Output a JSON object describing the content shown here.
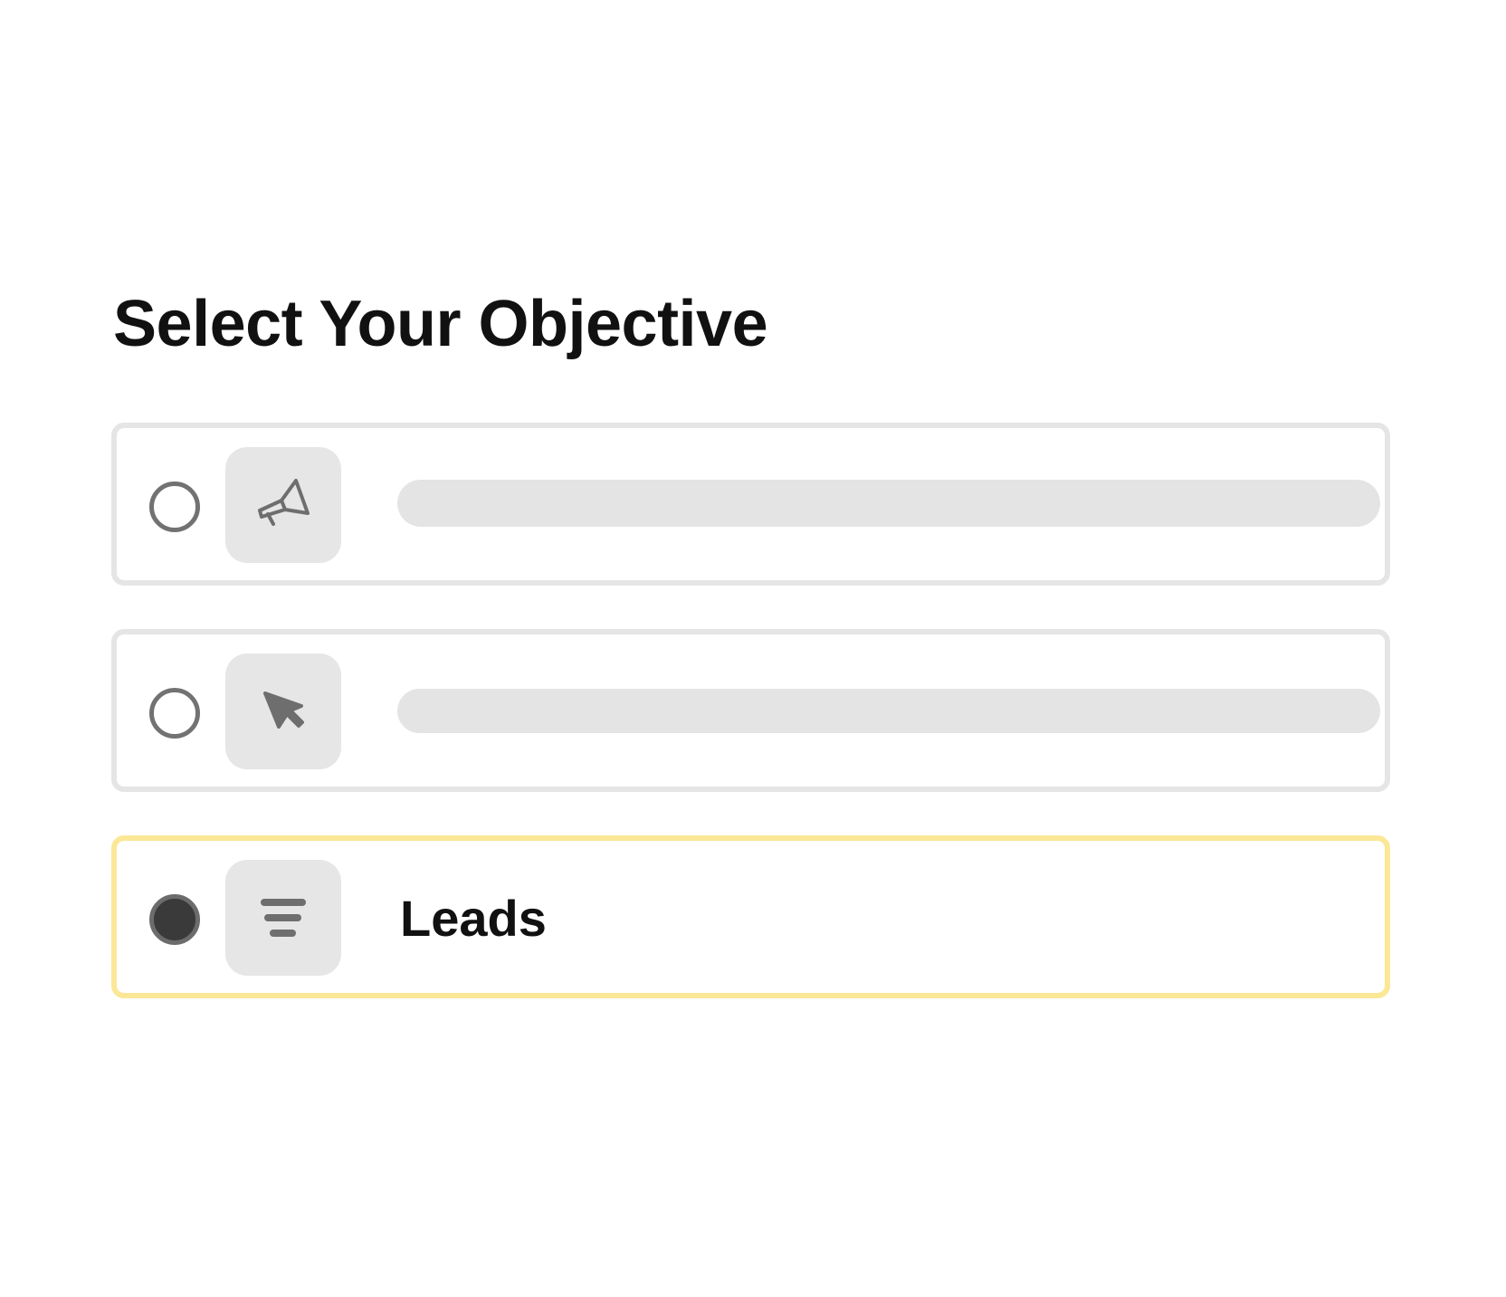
{
  "page": {
    "title": "Select Your Objective"
  },
  "options": [
    {
      "icon": "megaphone-icon",
      "label": "",
      "selected": false,
      "label_state": "placeholder"
    },
    {
      "icon": "cursor-icon",
      "label": "",
      "selected": false,
      "label_state": "placeholder"
    },
    {
      "icon": "funnel-filter-icon",
      "label": "Leads",
      "selected": true
    }
  ],
  "colors": {
    "card_border": "#e5e5e5",
    "selected_border": "#fbe796",
    "icon_tile_bg": "#e6e6e6",
    "icon_color": "#6e6e6e",
    "radio_border": "#727272",
    "radio_checked_fill": "#3a3a3a",
    "placeholder_bar": "#e4e4e4",
    "text": "#111111"
  }
}
